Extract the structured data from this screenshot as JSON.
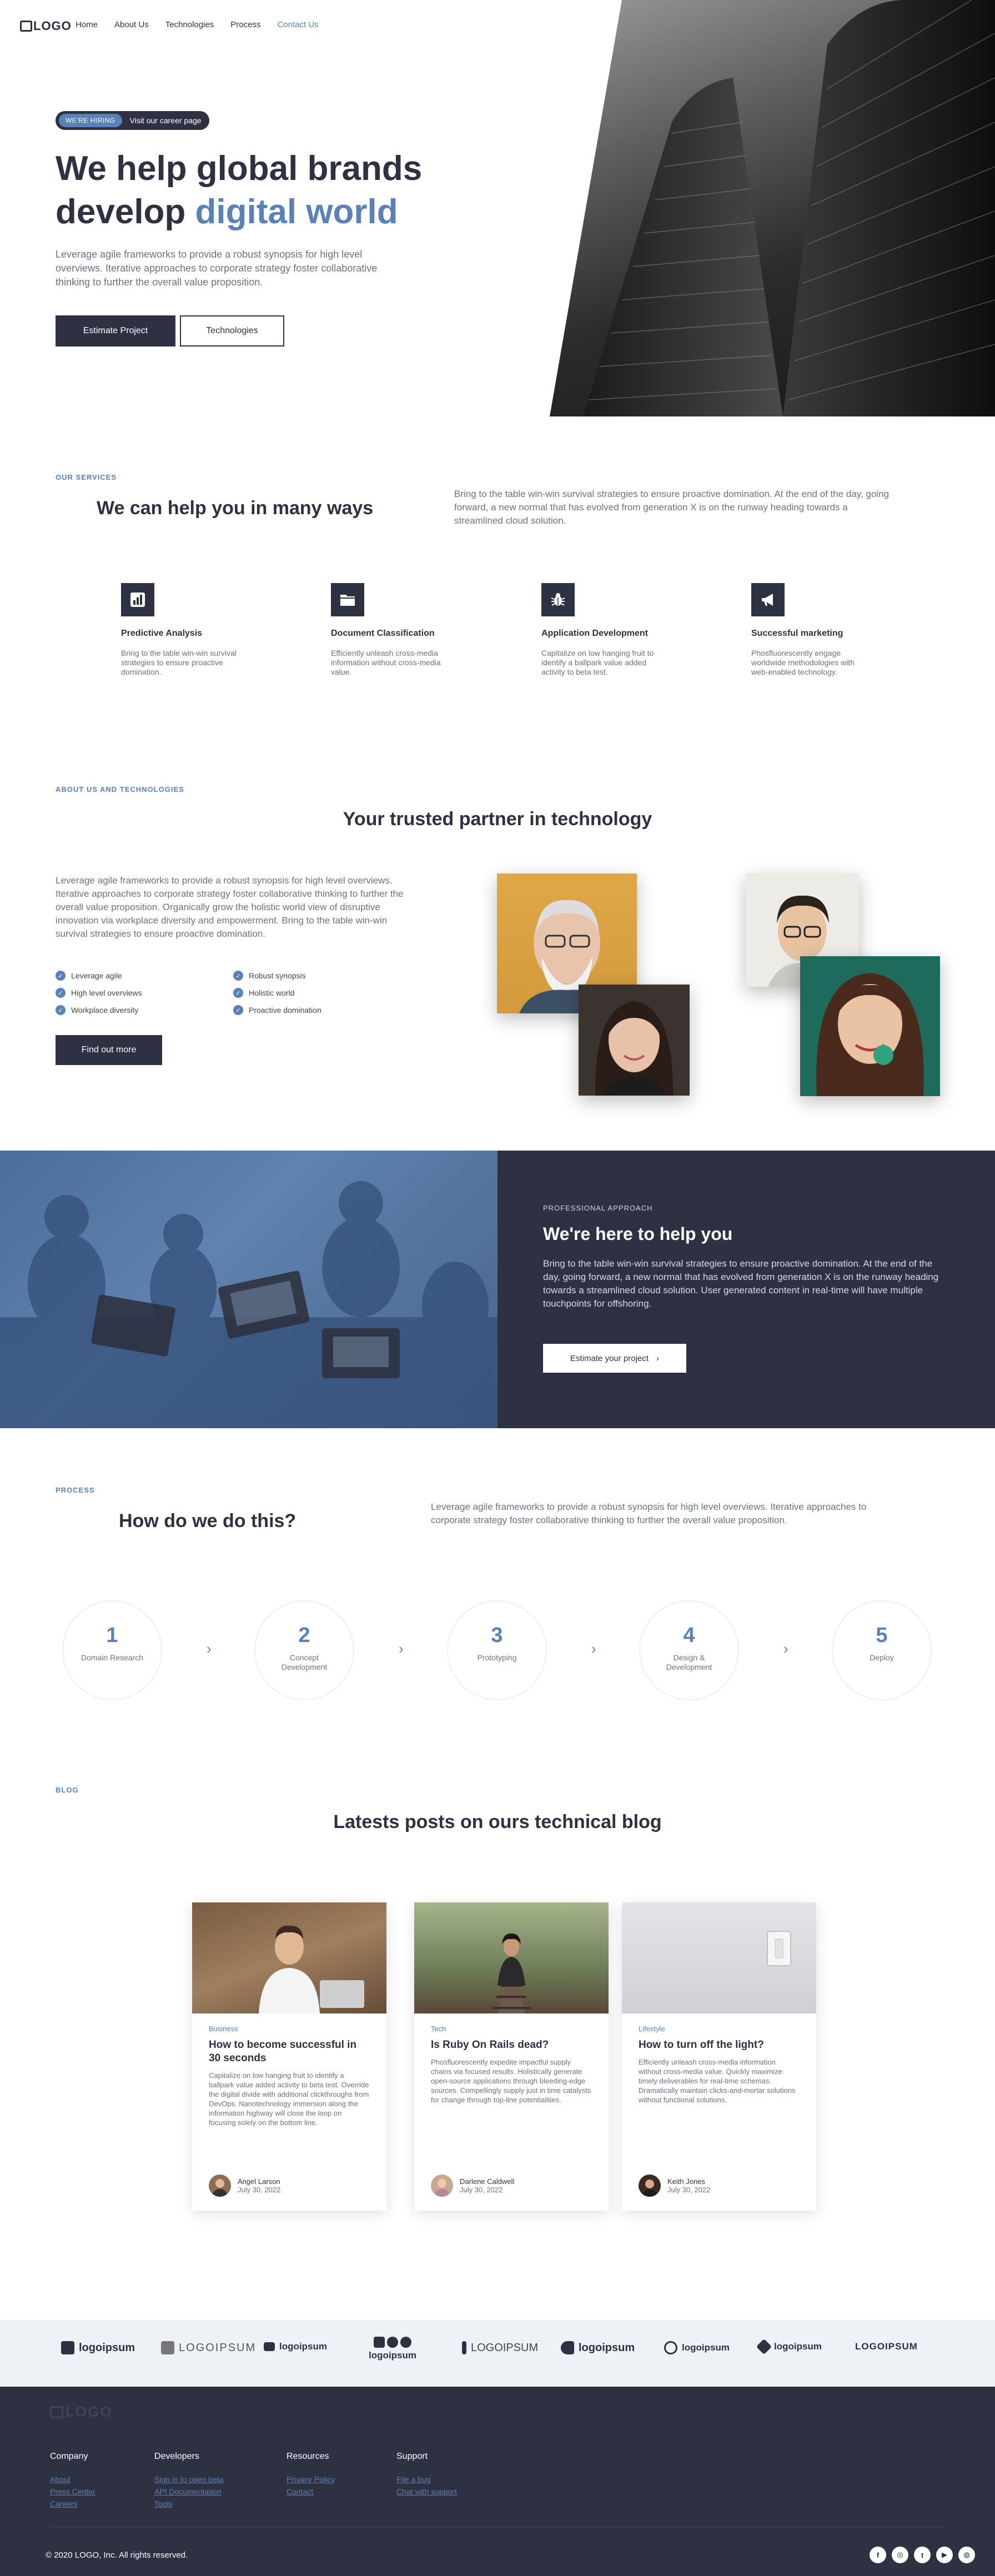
{
  "nav": {
    "logo": "LOGO",
    "links": [
      "Home",
      "About Us",
      "Technologies",
      "Process",
      "Contact Us"
    ]
  },
  "hero": {
    "badge_pill": "WE'RE HIRING",
    "badge_text": "Visit our career page",
    "title_line1": "We help global brands",
    "title_line2_plain": "develop ",
    "title_line2_accent": "digital world",
    "subtitle": "Leverage agile frameworks to provide a robust synopsis for high level overviews. Iterative approaches to corporate strategy foster collaborative thinking to further the overall value proposition.",
    "primary_button": "Estimate Project",
    "secondary_button": "Technologies"
  },
  "services": {
    "eyebrow": "OUR SERVICES",
    "title": "We can help you in many ways",
    "description": "Bring to the table win-win survival strategies to ensure proactive domination. At the end of the day, going forward, a new normal that has evolved from generation X is on the runway heading towards a streamlined cloud solution.",
    "items": [
      {
        "icon": "bar-chart-icon",
        "title": "Predictive Analysis",
        "text": "Bring to the table win-win survival strategies to ensure proactive domination."
      },
      {
        "icon": "folder-icon",
        "title": "Document Classification",
        "text": "Efficiently unleash cross-media information without cross-media value."
      },
      {
        "icon": "bug-icon",
        "title": "Application Development",
        "text": "Capitalize on low hanging fruit to identify a ballpark value added activity to beta test."
      },
      {
        "icon": "megaphone-icon",
        "title": "Successful marketing",
        "text": "Phosfluorescently engage worldwide methodologies with web-enabled technology."
      }
    ]
  },
  "about": {
    "eyebrow": "ABOUT US AND TECHNOLOGIES",
    "title": "Your trusted partner in technology",
    "paragraph": "Leverage agile frameworks to provide a robust synopsis for high level overviews. Iterative approaches to corporate strategy foster collaborative thinking to further the overall value proposition. Organically grow the holistic world view of disruptive innovation via workplace diversity and empowerment. Bring to the table win-win survival strategies to ensure proactive domination.",
    "checklist": [
      "Leverage agile",
      "Robust synopsis",
      "High level overviews",
      "Holistic world",
      "Workplace diversity",
      "Proactive domination"
    ],
    "button": "Find out more"
  },
  "help": {
    "eyebrow": "PROFESSIONAL APPROACH",
    "title": "We're here to help you",
    "text": "Bring to the table win-win survival strategies to ensure proactive domination. At the end of the day, going forward, a new normal that has evolved from generation X is on the runway heading towards a streamlined cloud solution. User generated content in real-time will have multiple touchpoints for offshoring.",
    "button": "Estimate your project"
  },
  "process": {
    "eyebrow": "PROCESS",
    "title": "How do we do this?",
    "description": "Leverage agile frameworks to provide a robust synopsis for high level overviews. Iterative approaches to corporate strategy foster collaborative thinking to further the overall value proposition.",
    "steps": [
      {
        "number": "1",
        "label": "Domain Research"
      },
      {
        "number": "2",
        "label": "Concept Development"
      },
      {
        "number": "3",
        "label": "Prototyping"
      },
      {
        "number": "4",
        "label": "Design & Development"
      },
      {
        "number": "5",
        "label": "Deploy"
      }
    ]
  },
  "blog": {
    "eyebrow": "BLOG",
    "title": "Latests posts on ours technical blog",
    "posts": [
      {
        "category": "Business",
        "title": "How to become successful in 30 seconds",
        "excerpt": "Capitalize on low hanging fruit to identify a ballpark value added activity to beta test. Override the digital divide with additional clickthroughs from DevOps. Nanotechnology immersion along the information highway will close the loop on focusing solely on the bottom line.",
        "author": "Angel Larson",
        "date": "July 30, 2022"
      },
      {
        "category": "Tech",
        "title": "Is Ruby On Rails dead?",
        "excerpt": "Phosfluorescently expedite impactful supply chains via focused results. Holistically generate open-source applications through bleeding-edge sources. Compellingly supply just in time catalysts for change through top-line potentialities.",
        "author": "Darlene Caldwell",
        "date": "July 30, 2022"
      },
      {
        "category": "Lifestyle",
        "title": "How to turn off the light?",
        "excerpt": "Efficiently unleash cross-media information without cross-media value. Quickly maximize timely deliverables for real-time schemas. Dramatically maintain clicks-and-mortar solutions without functional solutions.",
        "author": "Keith Jones",
        "date": "July 30, 2022"
      }
    ]
  },
  "partners": [
    "logoipsum",
    "LOGOIPSUM",
    "logoipsum",
    "logoipsum",
    "LOGOIPSUM",
    "logoipsum",
    "logoipsum",
    "logoipsum",
    "LOGOIPSUM"
  ],
  "footer": {
    "logo": "LOGO",
    "columns": [
      {
        "heading": "Company",
        "links": [
          "About",
          "Press Center",
          "Careers"
        ]
      },
      {
        "heading": "Developers",
        "links": [
          "Sign in to open beta",
          "API Documentation",
          "Tools"
        ]
      },
      {
        "heading": "Resources",
        "links": [
          "Privacy Policy",
          "Contact"
        ]
      },
      {
        "heading": "Support",
        "links": [
          "File a bug",
          "Chat with support"
        ]
      }
    ],
    "copyright": "© 2020 LOGO, Inc. All rights reserved.",
    "social": [
      {
        "icon": "facebook-icon",
        "glyph": "f"
      },
      {
        "icon": "instagram-icon",
        "glyph": "◎"
      },
      {
        "icon": "twitter-icon",
        "glyph": "t"
      },
      {
        "icon": "youtube-icon",
        "glyph": "▶"
      },
      {
        "icon": "dribbble-icon",
        "glyph": "◍"
      }
    ]
  },
  "colors": {
    "primary": "#2d3142",
    "accent": "#5a82b8",
    "muted": "#6b7280",
    "partners_bg": "#eef1f6"
  }
}
